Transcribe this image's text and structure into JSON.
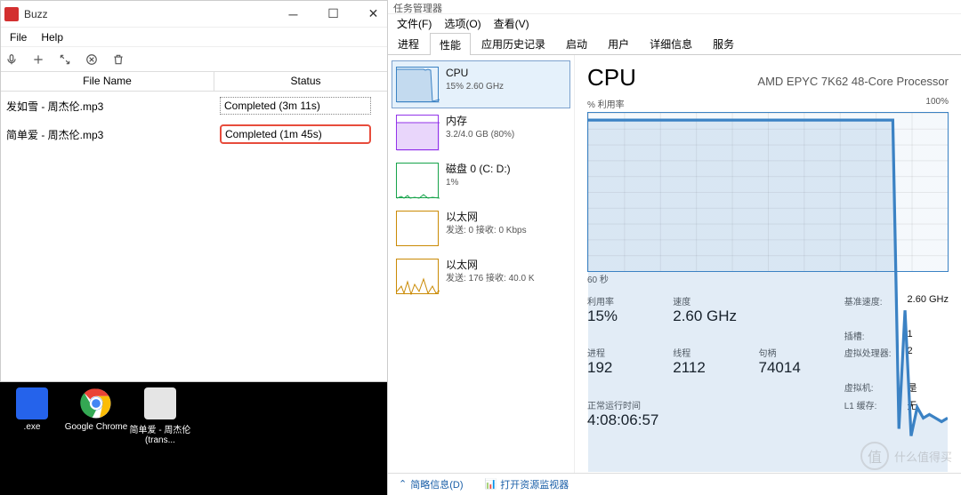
{
  "buzz": {
    "title": "Buzz",
    "menu": {
      "file": "File",
      "help": "Help"
    },
    "cols": {
      "filename": "File Name",
      "status": "Status"
    },
    "rows": [
      {
        "name": "发如雪 - 周杰伦.mp3",
        "status": "Completed (3m 11s)",
        "highlight": false
      },
      {
        "name": "简单爱 - 周杰伦.mp3",
        "status": "Completed (1m 45s)",
        "highlight": true
      }
    ]
  },
  "desktop": {
    "items": [
      {
        "label": ".exe"
      },
      {
        "label": "Google Chrome"
      },
      {
        "label": "简单爱 - 周杰伦 (trans..."
      }
    ]
  },
  "taskmgr": {
    "title": "任务管理器",
    "menu": {
      "file": "文件(F)",
      "options": "选项(O)",
      "view": "查看(V)"
    },
    "tabs": [
      "进程",
      "性能",
      "应用历史记录",
      "启动",
      "用户",
      "详细信息",
      "服务"
    ],
    "active_tab": 1,
    "sidebar": [
      {
        "key": "cpu",
        "title": "CPU",
        "sub": "15% 2.60 GHz"
      },
      {
        "key": "mem",
        "title": "内存",
        "sub": "3.2/4.0 GB (80%)"
      },
      {
        "key": "disk",
        "title": "磁盘 0 (C: D:)",
        "sub": "1%"
      },
      {
        "key": "eth1",
        "title": "以太网",
        "sub": "发送: 0 接收: 0 Kbps"
      },
      {
        "key": "eth2",
        "title": "以太网",
        "sub": "发送: 176 接收: 40.0 K"
      }
    ],
    "main": {
      "heading": "CPU",
      "processor": "AMD EPYC 7K62 48-Core Processor",
      "chart_label_left": "% 利用率",
      "chart_label_right": "100%",
      "chart_bottom": "60 秒",
      "stats": {
        "util_label": "利用率",
        "util": "15%",
        "speed_label": "速度",
        "speed": "2.60 GHz",
        "base_label": "基准速度:",
        "base": "2.60 GHz",
        "sockets_label": "插槽:",
        "sockets": "1",
        "vproc_label": "虚拟处理器:",
        "vproc": "2",
        "vm_label": "虚拟机:",
        "vm": "是",
        "l1_label": "L1 缓存:",
        "l1": "无",
        "proc_label": "进程",
        "proc": "192",
        "threads_label": "线程",
        "threads": "2112",
        "handles_label": "句柄",
        "handles": "74014",
        "uptime_label": "正常运行时间",
        "uptime": "4:08:06:57"
      }
    },
    "footer": {
      "less": "简略信息(D)",
      "resmon": "打开资源监视器"
    }
  },
  "watermark": {
    "badge": "值",
    "text": "什么值得买"
  },
  "chart_data": {
    "type": "line",
    "title": "CPU % 利用率",
    "ylabel": "% 利用率",
    "ylim": [
      0,
      100
    ],
    "xlabel": "秒",
    "x_span_seconds": 60,
    "values": [
      98,
      98,
      98,
      98,
      98,
      98,
      98,
      98,
      98,
      98,
      98,
      98,
      98,
      98,
      98,
      98,
      98,
      98,
      98,
      98,
      98,
      98,
      98,
      98,
      98,
      98,
      98,
      98,
      98,
      98,
      98,
      98,
      98,
      98,
      98,
      98,
      98,
      98,
      98,
      98,
      98,
      98,
      98,
      98,
      98,
      98,
      98,
      98,
      98,
      98,
      98,
      12,
      45,
      10,
      18,
      15,
      16,
      15,
      14,
      15
    ]
  }
}
